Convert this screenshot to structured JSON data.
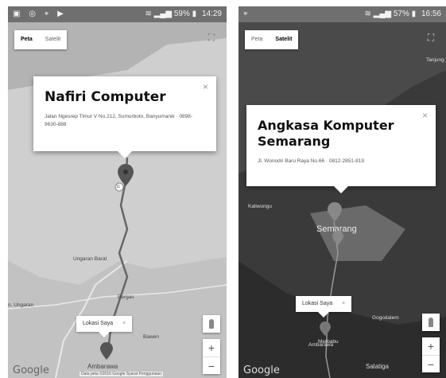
{
  "left": {
    "status": {
      "icons": [
        "image-icon",
        "image-icon",
        "pin-icon",
        "play-icon"
      ],
      "battery": "59%",
      "time": "14:29"
    },
    "map_type": {
      "map_label": "Peta",
      "satellite_label": "Satelit",
      "active": "map"
    },
    "info_window": {
      "name": "Nafiri Computer",
      "address": "Jalan Ngesrep Timur V No.212, Sumurboto, Banyumanik · 0898-9630-888",
      "close_label": "×"
    },
    "places": {
      "ungaran_barat": "Ungaran Barat",
      "ungaran": "n. Ungaran",
      "bergas": "Bergas",
      "bawen": "Bawen",
      "ambarawa": "Ambarawa",
      "semarang_partial": "Se   arang",
      "route_11": "11"
    },
    "my_location": {
      "label": "Lokasi Saya",
      "close": "×"
    },
    "zoom": {
      "in": "+",
      "out": "−"
    },
    "google": "Google",
    "attribution": "Data peta ©2016 Google  Syarat Penggunaan"
  },
  "right": {
    "status": {
      "icons": [
        "pin-icon"
      ],
      "battery": "57%",
      "time": "16:56"
    },
    "map_type": {
      "map_label": "Peta",
      "satellite_label": "Satelit",
      "active": "satellite"
    },
    "info_window": {
      "name_line1": "Angkasa Komputer",
      "name_line2": "Semarang",
      "address": "Jl. Wonodri Baru Raya No.66 · 0812-2851-819",
      "close_label": "×"
    },
    "places": {
      "semarang": "Semarang",
      "kaliwungu": "Kaliwungu",
      "tanjung": "Tanjung",
      "gogodalem": "Gogodalem",
      "ambarawa": "Ambarawa",
      "salatiga": "Salatiga",
      "merbabu": "Merbabu"
    },
    "my_location": {
      "label": "Lokasi Saya",
      "close": "×"
    },
    "zoom": {
      "in": "+",
      "out": "−"
    },
    "google": "Google"
  },
  "colors": {
    "map_bg": "#cfcfcf",
    "water": "#b8b8b8",
    "satellite_bg": "#3a3a3a",
    "road": "#ffffff",
    "route": "#666666",
    "marker": "#555555"
  }
}
